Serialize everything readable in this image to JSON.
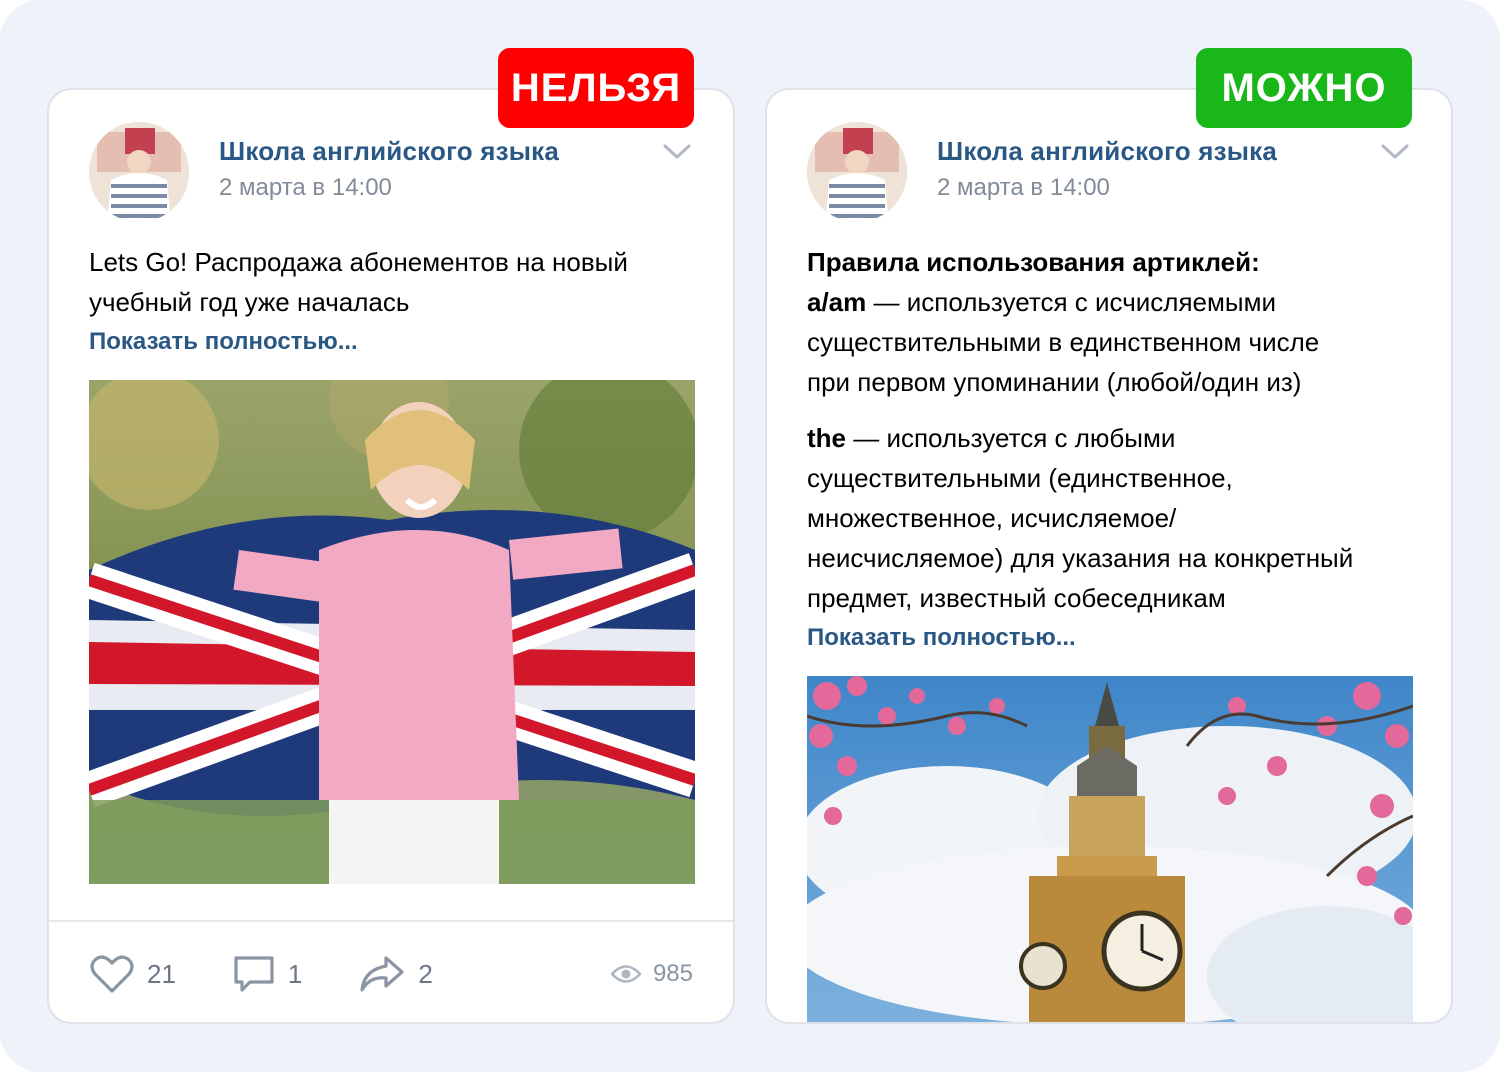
{
  "labels": {
    "bad": "НЕЛЬЗЯ",
    "good": "МОЖНО"
  },
  "colors": {
    "bad": "#ff0000",
    "good": "#1ab71a",
    "link": "#2a5885"
  },
  "left_post": {
    "group_name": "Школа английского языка",
    "date": "2 марта в 14:00",
    "text_line1": "Lets Go! Распродажа абонементов на новый",
    "text_line2": "учебный год уже началась",
    "show_more": "Показать полностью...",
    "likes": "21",
    "comments": "1",
    "shares": "2",
    "views": "985",
    "icons": [
      "heart-icon",
      "comment-icon",
      "share-icon",
      "eye-icon",
      "chevron-down-icon"
    ]
  },
  "right_post": {
    "group_name": "Школа английского языка",
    "date": "2 марта в 14:00",
    "heading": "Правила использования артиклей:",
    "rule1_term": "a/am",
    "rule1_line1": " — используется с исчисляемыми",
    "rule1_line2": "существительными в единственном числе",
    "rule1_line3": "при первом упоминании (любой/один из)",
    "rule2_term": "the",
    "rule2_line1": " — используется с любыми",
    "rule2_line2": "существительными (единственное,",
    "rule2_line3": "множественное, исчисляемое/",
    "rule2_line4": "неисчисляемое) для указания на конкретный",
    "rule2_line5": "предмет, известный собеседникам",
    "show_more": "Показать полностью..."
  }
}
